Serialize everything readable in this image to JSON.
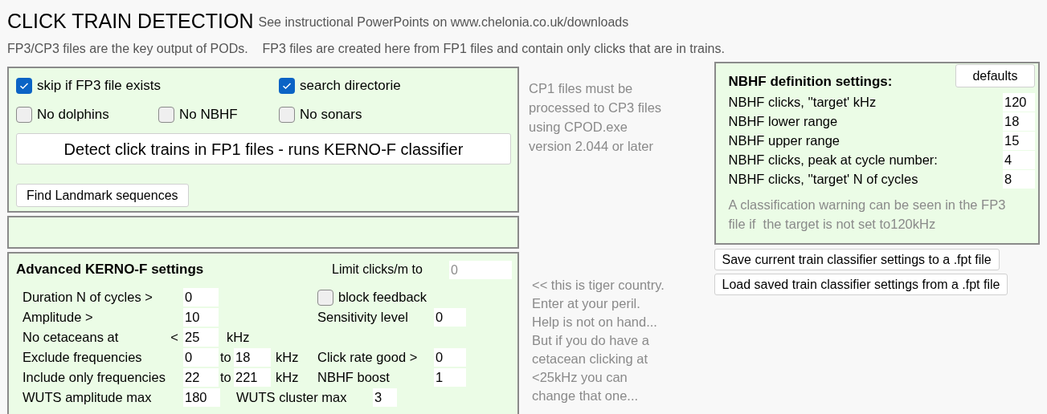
{
  "header": {
    "title": "CLICK TRAIN DETECTION",
    "link_note": "See instructional PowerPoints on www.chelonia.co.uk/downloads",
    "subtitle": "FP3/CP3 files are the key output of PODs.    FP3 files are created here from FP1 files and contain only clicks that are in trains."
  },
  "detect_panel": {
    "checkbox_rows": [
      [
        {
          "label": "skip if FP3 file exists",
          "checked": true
        },
        {
          "label": "search directorie",
          "checked": true
        }
      ],
      [
        {
          "label": "No dolphins",
          "checked": false
        },
        {
          "label": "No NBHF",
          "checked": false
        },
        {
          "label": "No sonars",
          "checked": false
        }
      ]
    ],
    "detect_button": "Detect click trains in FP1 files - runs KERNO-F classifier",
    "landmark_button": "Find Landmark sequences"
  },
  "advanced": {
    "title": "Advanced KERNO-F settings",
    "limit": {
      "label": "Limit clicks/m to",
      "value": "0",
      "disabled": true
    },
    "rows": [
      {
        "kind": "single",
        "label": "Duration N of cycles >",
        "value": "0",
        "right": {
          "kind": "checkbox",
          "label": "block feedback",
          "checked": false
        }
      },
      {
        "kind": "single",
        "label": "Amplitude >",
        "value": "10",
        "right": {
          "kind": "field",
          "label": "Sensitivity level",
          "value": "0"
        }
      },
      {
        "kind": "single",
        "label": "No cetaceans at",
        "prefix": "<",
        "value": "25",
        "unit": "kHz"
      },
      {
        "kind": "range",
        "label": "Exclude frequencies",
        "value": "0",
        "to": "to",
        "to_value": "18",
        "unit": "kHz",
        "right": {
          "kind": "field",
          "label": "Click rate good >",
          "value": "0"
        }
      },
      {
        "kind": "range",
        "label": "Include only frequencies",
        "value": "22",
        "to": "to",
        "to_value": "221",
        "unit": "kHz",
        "right": {
          "kind": "field",
          "label": "NBHF boost",
          "value": "1"
        }
      },
      {
        "kind": "pair",
        "label": "WUTS amplitude max",
        "value": "180",
        "second_label": "WUTS cluster max",
        "second_value": "3"
      }
    ]
  },
  "notes": {
    "cp1": "CP1 files must be processed to CP3 files using CPOD.exe version 2.044 or later",
    "tiger": [
      "<< this is tiger country.",
      "Enter at your peril.",
      "Help is not on hand...",
      "But if you do have a",
      "cetacean clicking at",
      "<25kHz you can",
      "change that one..."
    ]
  },
  "nbhf": {
    "title": "NBHF definition settings:",
    "defaults_button": "defaults",
    "rows": [
      {
        "label": "NBHF clicks, ''target'  kHz",
        "value": "120"
      },
      {
        "label": "NBHF lower range",
        "value": "18"
      },
      {
        "label": "NBHF upper range",
        "value": "15"
      },
      {
        "label": "NBHF clicks, peak at cycle number:",
        "value": "4"
      },
      {
        "label": "NBHF clicks, ''target'  N of cycles",
        "value": "8"
      }
    ],
    "note": "A classification warning can be seen in the FP3 file if  the target is not set to120kHz"
  },
  "file_buttons": [
    "Save current train classifier settings to a .fpt file",
    "Load saved train classifier settings from a .fpt file"
  ]
}
